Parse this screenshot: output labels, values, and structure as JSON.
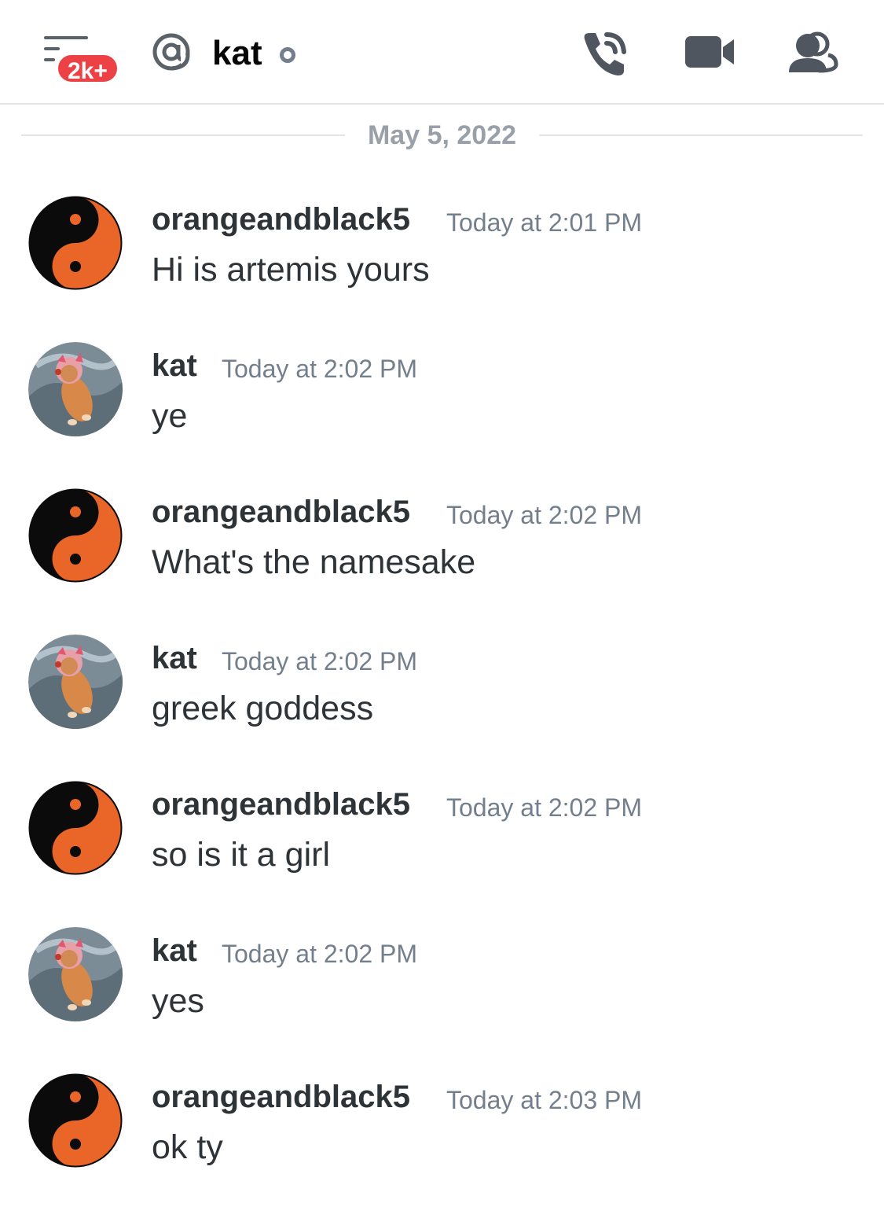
{
  "header": {
    "badge": "2k+",
    "channel_name": "kat",
    "icons": [
      "hamburger-menu-icon",
      "at-icon",
      "status-offline-icon",
      "call-icon",
      "video-icon",
      "members-icon"
    ]
  },
  "date_divider": "May 5, 2022",
  "messages": [
    {
      "author": "orangeandblack5",
      "timestamp": "Today at 2:01 PM",
      "text": "Hi is artemis yours",
      "avatar": "yin-yang-avatar"
    },
    {
      "author": "kat",
      "timestamp": "Today at 2:02 PM",
      "text": "ye",
      "avatar": "kitten-avatar"
    },
    {
      "author": "orangeandblack5",
      "timestamp": "Today at 2:02 PM",
      "text": "What's the namesake",
      "avatar": "yin-yang-avatar"
    },
    {
      "author": "kat",
      "timestamp": "Today at 2:02 PM",
      "text": "greek goddess",
      "avatar": "kitten-avatar"
    },
    {
      "author": "orangeandblack5",
      "timestamp": "Today at 2:02 PM",
      "text": "so is it a girl",
      "avatar": "yin-yang-avatar"
    },
    {
      "author": "kat",
      "timestamp": "Today at 2:02 PM",
      "text": "yes",
      "avatar": "kitten-avatar"
    },
    {
      "author": "orangeandblack5",
      "timestamp": "Today at 2:03 PM",
      "text": "ok ty",
      "avatar": "yin-yang-avatar"
    }
  ],
  "colors": {
    "badge": "#ed4245",
    "yin_yang_orange": "#ea6528",
    "icon_gray": "#4f5660",
    "timestamp": "#747f8d"
  }
}
